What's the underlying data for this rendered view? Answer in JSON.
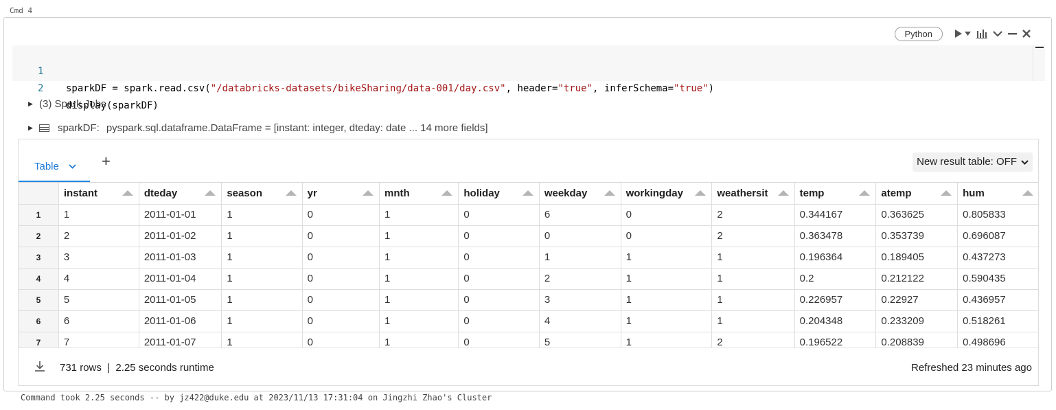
{
  "cmd_label": "Cmd 4",
  "toolbar": {
    "language": "Python",
    "icons": [
      "run-icon",
      "run-dropdown-icon",
      "chart-icon",
      "collapse-chevron-icon",
      "minimize-icon",
      "close-icon"
    ]
  },
  "code": {
    "lines": [
      {
        "num": "1",
        "prefix": "sparkDF = spark.read.csv(",
        "arg1": "\"/databricks-datasets/bikeSharing/data-001/day.csv\"",
        "mid1": ", header=",
        "arg2": "\"true\"",
        "mid2": ", inferSchema=",
        "arg3": "\"true\"",
        "suffix": ")"
      },
      {
        "num": "2",
        "text": "display(sparkDF)"
      }
    ]
  },
  "output": {
    "spark_jobs": "(3) Spark Jobs",
    "df_name": "sparkDF:",
    "df_schema": "pyspark.sql.dataframe.DataFrame = [instant: integer, dteday: date ... 14 more fields]"
  },
  "result": {
    "tab_label": "Table",
    "new_result_toggle": "New result table: OFF",
    "columns": [
      "instant",
      "dteday",
      "season",
      "yr",
      "mnth",
      "holiday",
      "weekday",
      "workingday",
      "weathersit",
      "temp",
      "atemp",
      "hum"
    ],
    "rows": [
      [
        "1",
        "1",
        "2011-01-01",
        "1",
        "0",
        "1",
        "0",
        "6",
        "0",
        "2",
        "0.344167",
        "0.363625",
        "0.805833"
      ],
      [
        "2",
        "2",
        "2011-01-02",
        "1",
        "0",
        "1",
        "0",
        "0",
        "0",
        "2",
        "0.363478",
        "0.353739",
        "0.696087"
      ],
      [
        "3",
        "3",
        "2011-01-03",
        "1",
        "0",
        "1",
        "0",
        "1",
        "1",
        "1",
        "0.196364",
        "0.189405",
        "0.437273"
      ],
      [
        "4",
        "4",
        "2011-01-04",
        "1",
        "0",
        "1",
        "0",
        "2",
        "1",
        "1",
        "0.2",
        "0.212122",
        "0.590435"
      ],
      [
        "5",
        "5",
        "2011-01-05",
        "1",
        "0",
        "1",
        "0",
        "3",
        "1",
        "1",
        "0.226957",
        "0.22927",
        "0.436957"
      ],
      [
        "6",
        "6",
        "2011-01-06",
        "1",
        "0",
        "1",
        "0",
        "4",
        "1",
        "1",
        "0.204348",
        "0.233209",
        "0.518261"
      ],
      [
        "7",
        "7",
        "2011-01-07",
        "1",
        "0",
        "1",
        "0",
        "5",
        "1",
        "2",
        "0.196522",
        "0.208839",
        "0.498696"
      ]
    ],
    "footer": {
      "stats": "731 rows  |  2.25 seconds runtime",
      "refreshed": "Refreshed 23 minutes ago"
    }
  },
  "command_took": "Command took 2.25 seconds -- by jz422@duke.edu at 2023/11/13 17:31:04 on Jingzhi Zhao's Cluster"
}
